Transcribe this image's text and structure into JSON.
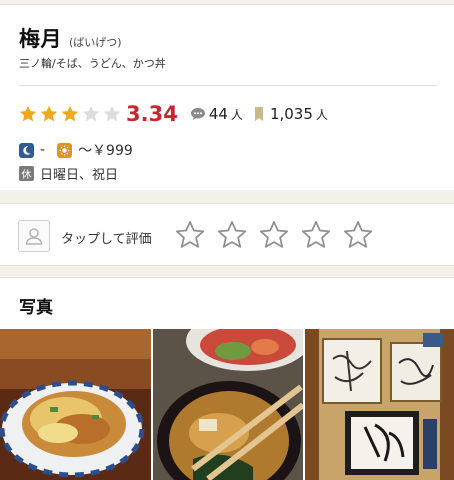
{
  "restaurant": {
    "name": "梅月",
    "reading": "(ばいげつ)",
    "genre": "三ノ輪/そば、うどん、かつ丼"
  },
  "rating": {
    "score": "3.34",
    "stars_filled": 3,
    "stars_total": 5,
    "reviews_count": "44",
    "reviews_unit": "人",
    "saves_count": "1,035",
    "saves_unit": "人"
  },
  "budget": {
    "dinner": "-",
    "lunch": "～￥999"
  },
  "holidays": {
    "badge": "休",
    "text": "日曜日、祝日"
  },
  "user_rating": {
    "prompt": "タップして評価",
    "stars": 5
  },
  "photos": {
    "title": "写真",
    "items": [
      "katsudon-photo",
      "miso-soup-photo",
      "autograph-boards-photo"
    ]
  },
  "colors": {
    "star_filled": "#f0a81c",
    "star_empty": "#dcdcdc",
    "score": "#c8272e",
    "dinner_badge": "#2f5b95",
    "lunch_badge": "#e0922b"
  }
}
